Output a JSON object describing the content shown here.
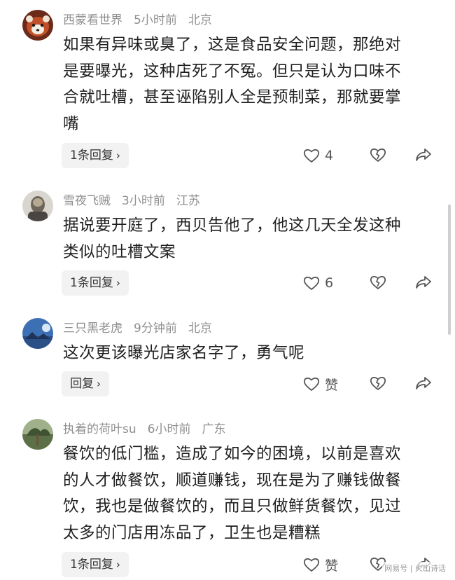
{
  "comments": [
    {
      "username": "西蒙看世界",
      "time": "5小时前",
      "location": "北京",
      "lines": [
        "如果有异味或臭了，这是食品安全问题，那绝对",
        "是要曝光，这种店死了不冤。但只是认为口味不",
        "合就吐槽，甚至诬陷别人全是预制菜，那就要掌",
        "嘴"
      ],
      "reply_label": "1条回复",
      "likes": "4"
    },
    {
      "username": "雪夜飞贼",
      "time": "3小时前",
      "location": "江苏",
      "lines": [
        "据说要开庭了，西贝告他了，他这几天全发这种",
        "类似的吐槽文案"
      ],
      "reply_label": "1条回复",
      "likes": "6"
    },
    {
      "username": "三只黑老虎",
      "time": "9分钟前",
      "location": "北京",
      "lines": [
        "这次更该曝光店家名字了，勇气呢"
      ],
      "reply_label": "回复",
      "likes": "赞"
    },
    {
      "username": "执着的荷叶su",
      "time": "6小时前",
      "location": "广东",
      "lines": [
        "餐饮的低门槛，造成了如今的困境，以前是喜欢",
        "的人才做餐饮，顺道赚钱，现在是为了赚钱做餐",
        "饮，我也是做餐饮的，而且只做鲜货餐饮，见过",
        "太多的门店用冻品了，卫生也是糟糕"
      ],
      "reply_label": "1条回复",
      "likes": "赞"
    }
  ],
  "icons": {
    "like": "heart-outline-icon",
    "dislike": "broken-heart-icon",
    "share": "share-arrow-icon",
    "reply_chevron": "›"
  },
  "watermark": "网易号 | 火山诗话",
  "colors": {
    "meta_text": "#8f8f8f",
    "body_text": "#1f1f1f",
    "reply_bg": "#f2f2f2"
  }
}
